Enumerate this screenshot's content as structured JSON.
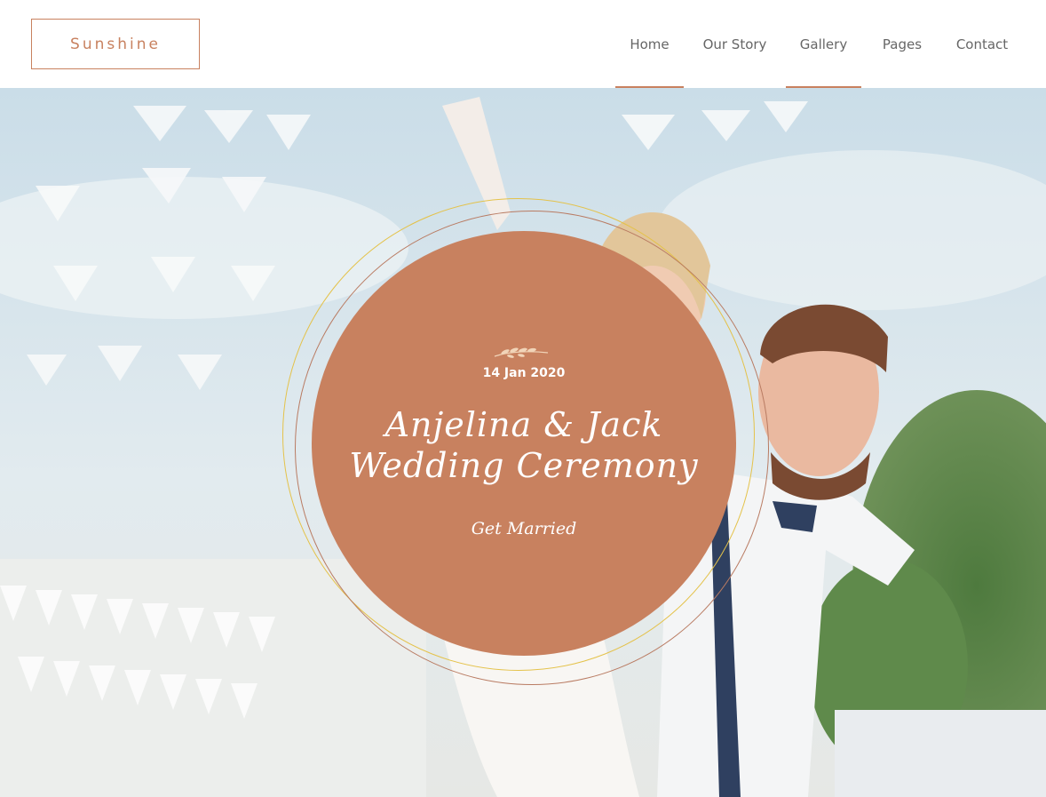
{
  "brand": {
    "logo_text": "Sunshine",
    "accent_color": "#c8815f"
  },
  "nav": {
    "items": [
      {
        "label": "Home",
        "active": true
      },
      {
        "label": "Our Story",
        "active": false
      },
      {
        "label": "Gallery",
        "active": true
      },
      {
        "label": "Pages",
        "active": false
      },
      {
        "label": "Contact",
        "active": false
      }
    ]
  },
  "hero": {
    "date": "14 Jan 2020",
    "title_line1": "Anjelina & Jack",
    "title_line2": "Wedding Ceremony",
    "subtitle": "Get Married",
    "circle_color": "#c8815f",
    "ring_color": "#e4c24a",
    "ornament_icon": "leaf-sprig-icon"
  }
}
